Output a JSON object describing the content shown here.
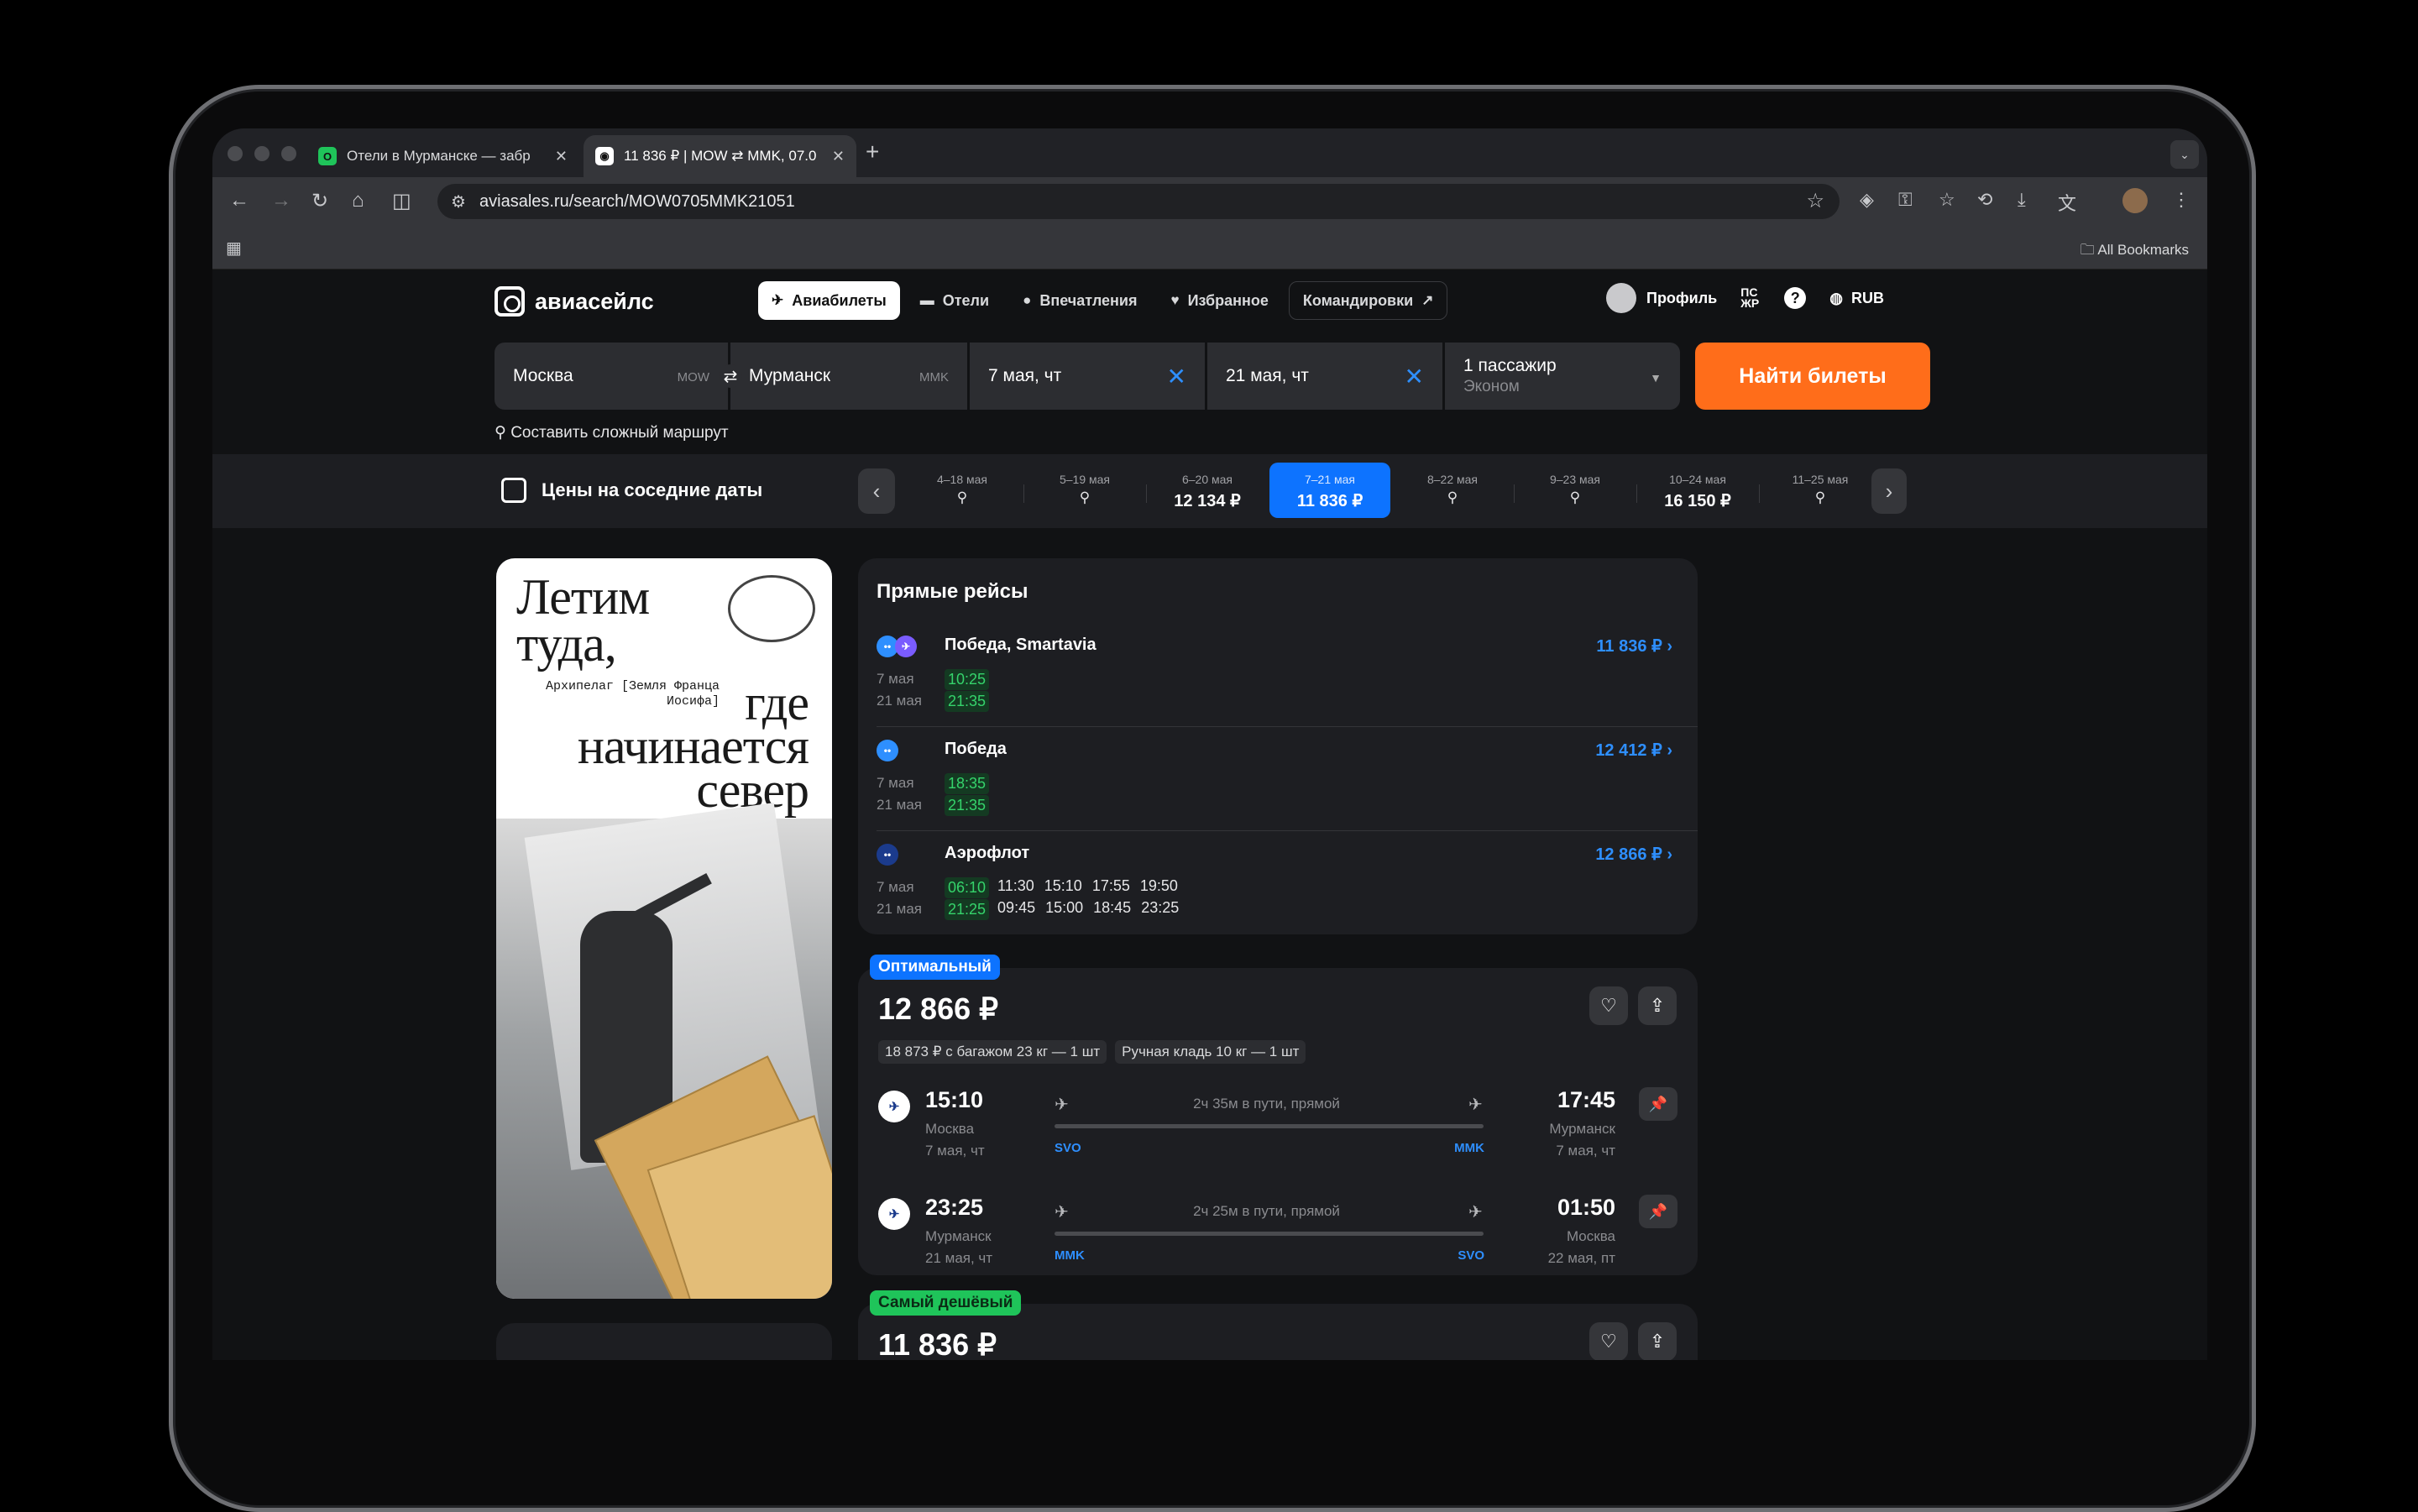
{
  "browser": {
    "tabs": [
      {
        "title": "Отели в Мурманске — забр",
        "favicon": "o"
      },
      {
        "title": "11 836 ₽ | MOW ⇄ MMK, 07.0",
        "favicon": "a"
      }
    ],
    "url": "aviasales.ru/search/MOW0705MMK21051",
    "bookmarks_label": "All Bookmarks"
  },
  "header": {
    "logo": "авиасейлс",
    "menu": [
      {
        "label": "Авиабилеты",
        "icon": "plane-icon"
      },
      {
        "label": "Отели",
        "icon": "bed-icon"
      },
      {
        "label": "Впечатления",
        "icon": "pin-icon"
      },
      {
        "label": "Избранное",
        "icon": "heart-icon"
      },
      {
        "label": "Командировки",
        "icon": "arrow-up-right-icon"
      }
    ],
    "profile": "Профиль",
    "currency": "RUB"
  },
  "search": {
    "origin": "Москва",
    "origin_code": "MOW",
    "destination": "Мурманск",
    "destination_code": "MMK",
    "depart": "7 мая, чт",
    "return": "21 мая, чт",
    "passengers": "1 пассажир",
    "class": "Эконом",
    "button": "Найти билеты",
    "complex_route": "Составить сложный маршрут"
  },
  "dates": {
    "title": "Цены на соседние даты",
    "items": [
      {
        "range": "4–18 мая",
        "price": ""
      },
      {
        "range": "5–19 мая",
        "price": ""
      },
      {
        "range": "6–20 мая",
        "price": "12 134 ₽"
      },
      {
        "range": "7–21 мая",
        "price": "11 836 ₽",
        "selected": true
      },
      {
        "range": "8–22 мая",
        "price": ""
      },
      {
        "range": "9–23 мая",
        "price": ""
      },
      {
        "range": "10–24 мая",
        "price": "16 150 ₽"
      },
      {
        "range": "11–25 мая",
        "price": ""
      }
    ]
  },
  "banner": {
    "line1": "Летим туда,",
    "line2": "где начинается север",
    "small": "Архипелаг [Земля Франца Иосифа]"
  },
  "direct": {
    "title": "Прямые рейсы",
    "rows": [
      {
        "airline": "Победа, Smartavia",
        "price": "11 836 ₽",
        "d1": "7 мая",
        "d2": "21 мая",
        "out": [
          "10:25"
        ],
        "back": [
          "21:35"
        ]
      },
      {
        "airline": "Победа",
        "price": "12 412 ₽",
        "d1": "7 мая",
        "d2": "21 мая",
        "out": [
          "18:35"
        ],
        "back": [
          "21:35"
        ]
      },
      {
        "airline": "Аэрофлот",
        "price": "12 866 ₽",
        "d1": "7 мая",
        "d2": "21 мая",
        "out": [
          "06:10",
          "11:30",
          "15:10",
          "17:55",
          "19:50"
        ],
        "back": [
          "21:25",
          "09:45",
          "15:00",
          "18:45",
          "23:25"
        ]
      }
    ]
  },
  "ticket1": {
    "badge": "Оптимальный",
    "price": "12 866 ₽",
    "chips": [
      "18 873 ₽ с багажом 23 кг — 1 шт",
      "Ручная кладь 10 кг — 1 шт"
    ],
    "segments": [
      {
        "dep_time": "15:10",
        "dep_city": "Москва",
        "dep_date": "7 мая, чт",
        "duration": "2ч 35м в пути, прямой",
        "from": "SVO",
        "to": "MMK",
        "arr_time": "17:45",
        "arr_city": "Мурманск",
        "arr_date": "7 мая, чт"
      },
      {
        "dep_time": "23:25",
        "dep_city": "Мурманск",
        "dep_date": "21 мая, чт",
        "duration": "2ч 25м в пути, прямой",
        "from": "MMK",
        "to": "SVO",
        "arr_time": "01:50",
        "arr_city": "Москва",
        "arr_date": "22 мая, пт"
      }
    ]
  },
  "ticket2": {
    "badge": "Самый дешёвый",
    "price": "11 836 ₽"
  },
  "colors": {
    "accent": "#0d73ff",
    "orange": "#ff6d1a",
    "green": "#1fc45a"
  }
}
